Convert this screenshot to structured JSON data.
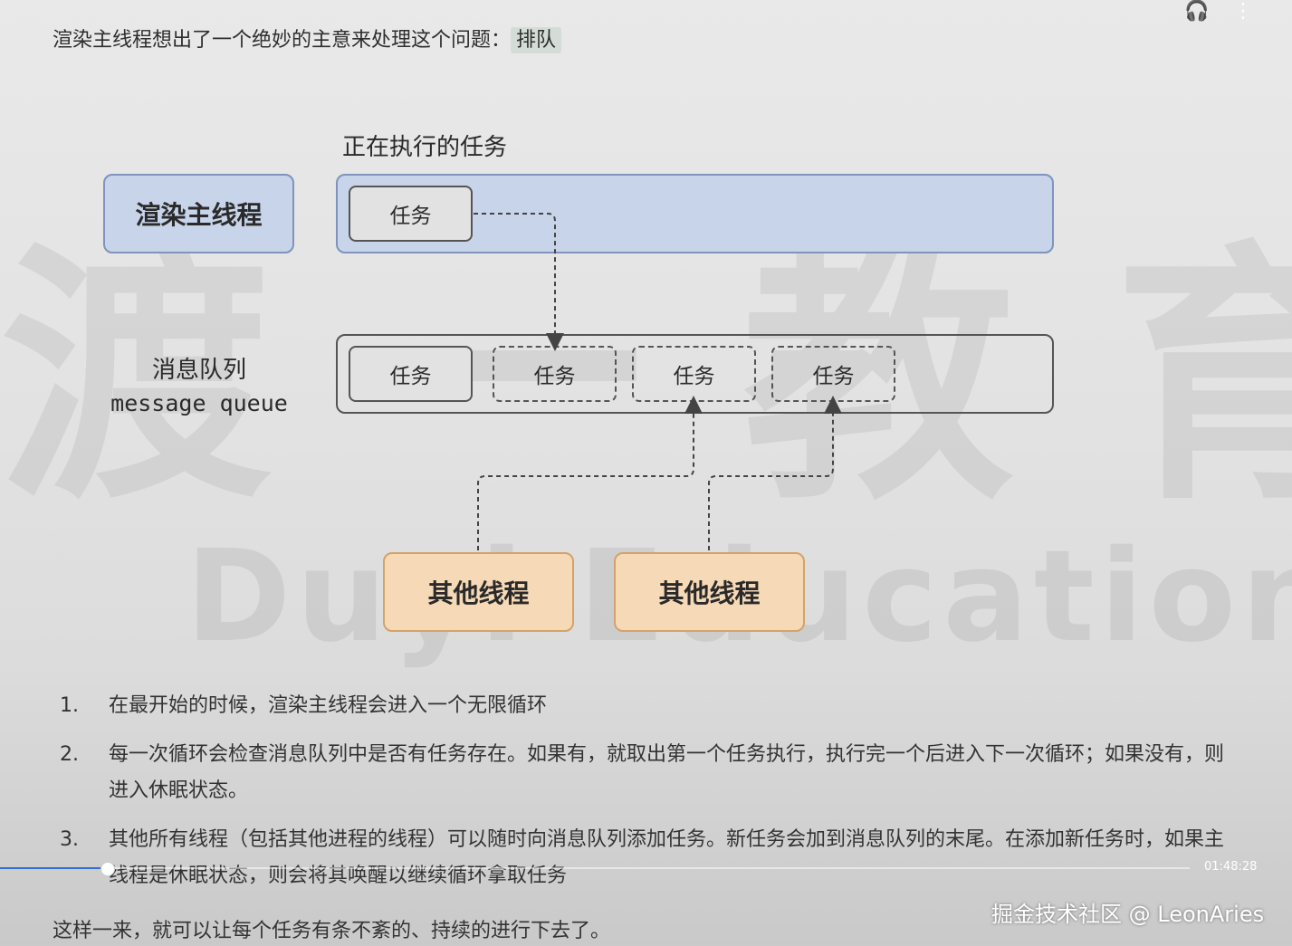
{
  "header": {
    "text": "渲染主线程想出了一个绝妙的主意来处理这个问题：",
    "highlight": "排队"
  },
  "diagram": {
    "executing_label": "正在执行的任务",
    "main_thread": "渲染主线程",
    "current_task": "任务",
    "queue_label_cn": "消息队列",
    "queue_label_en": "message queue",
    "queue_tasks": [
      "任务",
      "任务",
      "任务",
      "任务"
    ],
    "other_threads": [
      "其他线程",
      "其他线程"
    ]
  },
  "watermark": {
    "cn": "渡一教育",
    "en": "Duyi Education"
  },
  "steps": [
    {
      "num": "1.",
      "text": "在最开始的时候，渲染主线程会进入一个无限循环"
    },
    {
      "num": "2.",
      "text": "每一次循环会检查消息队列中是否有任务存在。如果有，就取出第一个任务执行，执行完一个后进入下一次循环；如果没有，则进入休眠状态。"
    },
    {
      "num": "3.",
      "text": "其他所有线程（包括其他进程的线程）可以随时向消息队列添加任务。新任务会加到消息队列的末尾。在添加新任务时，如果主线程是休眠状态，则会将其唤醒以继续循环拿取任务"
    }
  ],
  "closing": "这样一来，就可以让每个任务有条不紊的、持续的进行下去了。",
  "player": {
    "time": "01:48:28",
    "progress": 0.09
  },
  "credit": "掘金技术社区 @ LeonAries",
  "colors": {
    "thread_blue": "#c8d4e9",
    "other_orange": "#f6d9b6",
    "progress": "#2f6fd6"
  }
}
